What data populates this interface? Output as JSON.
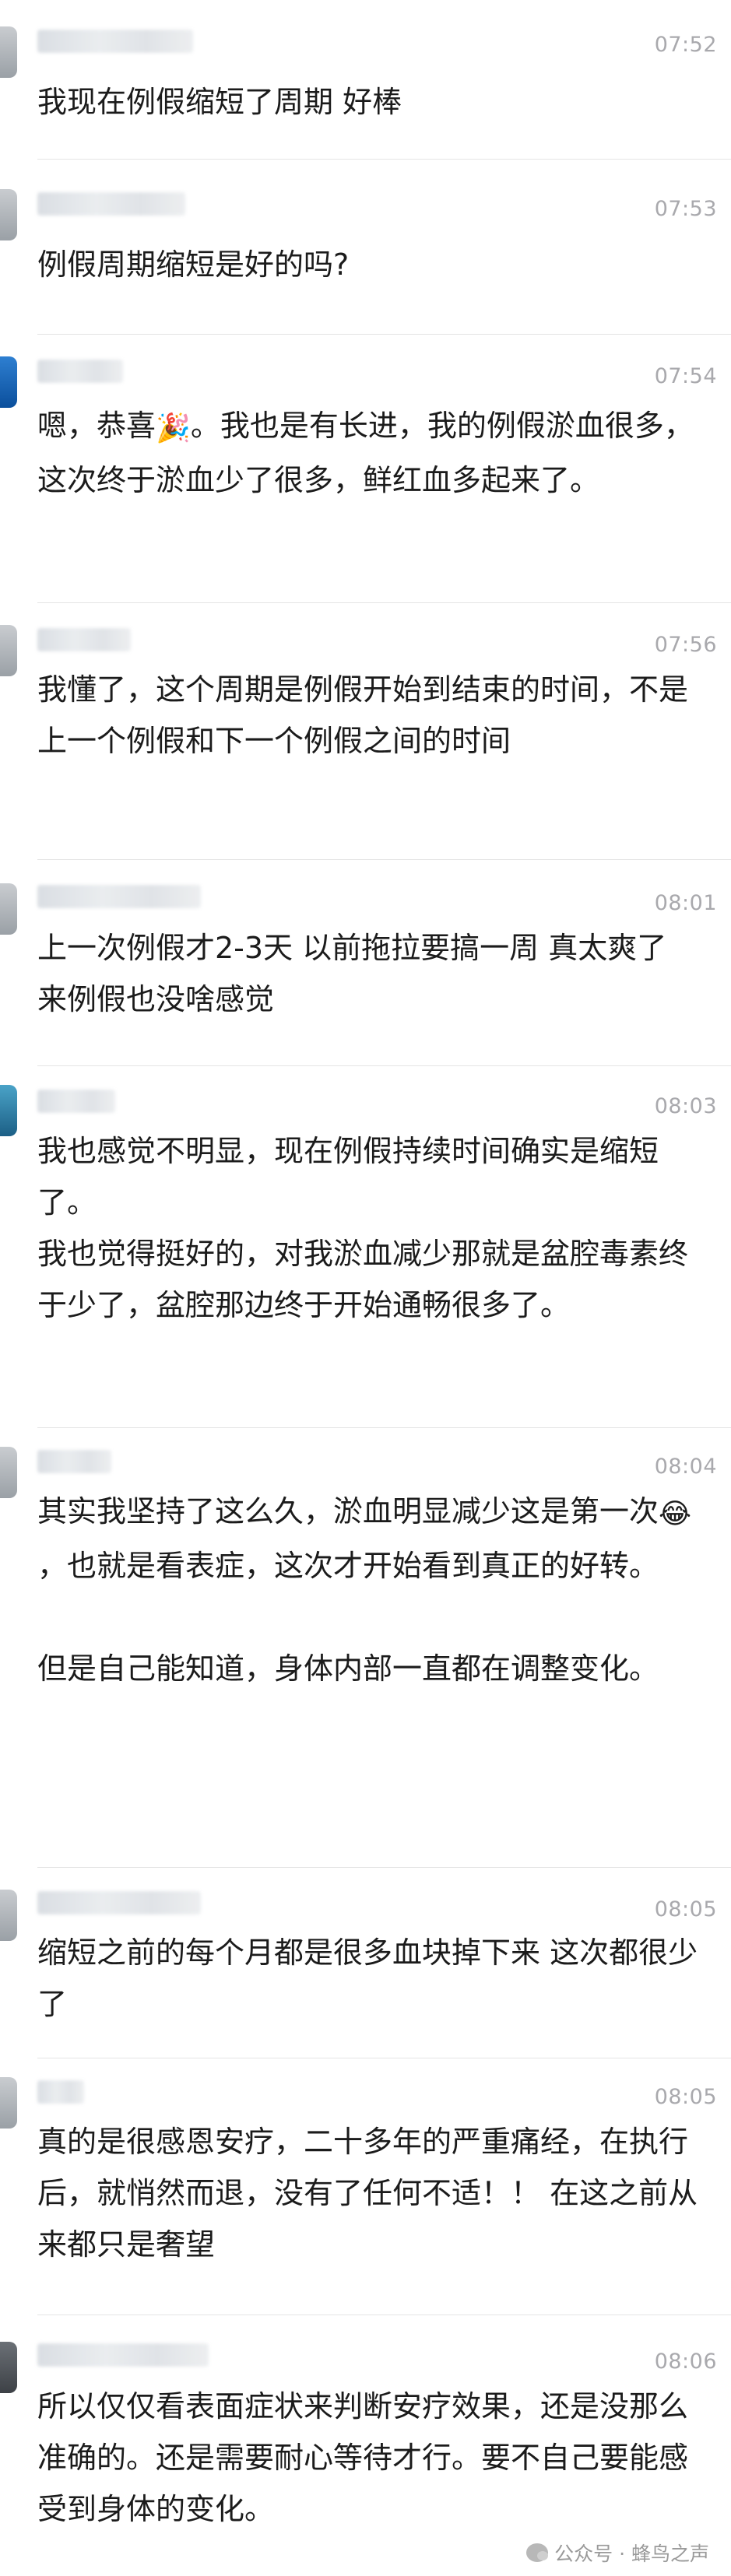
{
  "messages": [
    {
      "time": "07:52",
      "lines": [
        "我现在例假缩短了周期 好棒"
      ]
    },
    {
      "time": "07:53",
      "lines": [
        "例假周期缩短是好的吗?"
      ]
    },
    {
      "time": "07:54",
      "lines": [
        "嗯，恭喜",
        "🎉",
        "。我也是有长进，我的例假淤血很多，这次终于淤血少了很多，鲜红血多起来了。"
      ]
    },
    {
      "time": "07:56",
      "lines": [
        "我懂了，这个周期是例假开始到结束的时间，不是上一个例假和下一个例假之间的时间"
      ]
    },
    {
      "time": "08:01",
      "lines": [
        "上一次例假才2-3天 以前拖拉要搞一周  真太爽了 来例假也没啥感觉"
      ]
    },
    {
      "time": "08:03",
      "lines": [
        "我也感觉不明显，现在例假持续时间确实是缩短了。",
        "我也觉得挺好的，对我淤血减少那就是盆腔毒素终于少了，盆腔那边终于开始通畅很多了。"
      ]
    },
    {
      "time": "08:04",
      "lines": [
        "其实我坚持了这么久，淤血明显减少这是第一次",
        "😂",
        "，也就是看表症，这次才开始看到真正的好转。",
        "但是自己能知道，身体内部一直都在调整变化。"
      ]
    },
    {
      "time": "08:05",
      "lines": [
        "缩短之前的每个月都是很多血块掉下来  这次都很少了"
      ]
    },
    {
      "time": "08:05",
      "lines": [
        "真的是很感恩安疗，二十多年的严重痛经，在执行后，就悄然而退，没有了任何不适！！ 在这之前从来都只是奢望"
      ]
    },
    {
      "time": "08:06",
      "lines": [
        "所以仅仅看表面症状来判断安疗效果，还是没那么准确的。还是需要耐心等待才行。要不自己要能感受到身体的变化。"
      ]
    }
  ],
  "watermark": {
    "label": "公众号 · 蜂鸟之声"
  }
}
